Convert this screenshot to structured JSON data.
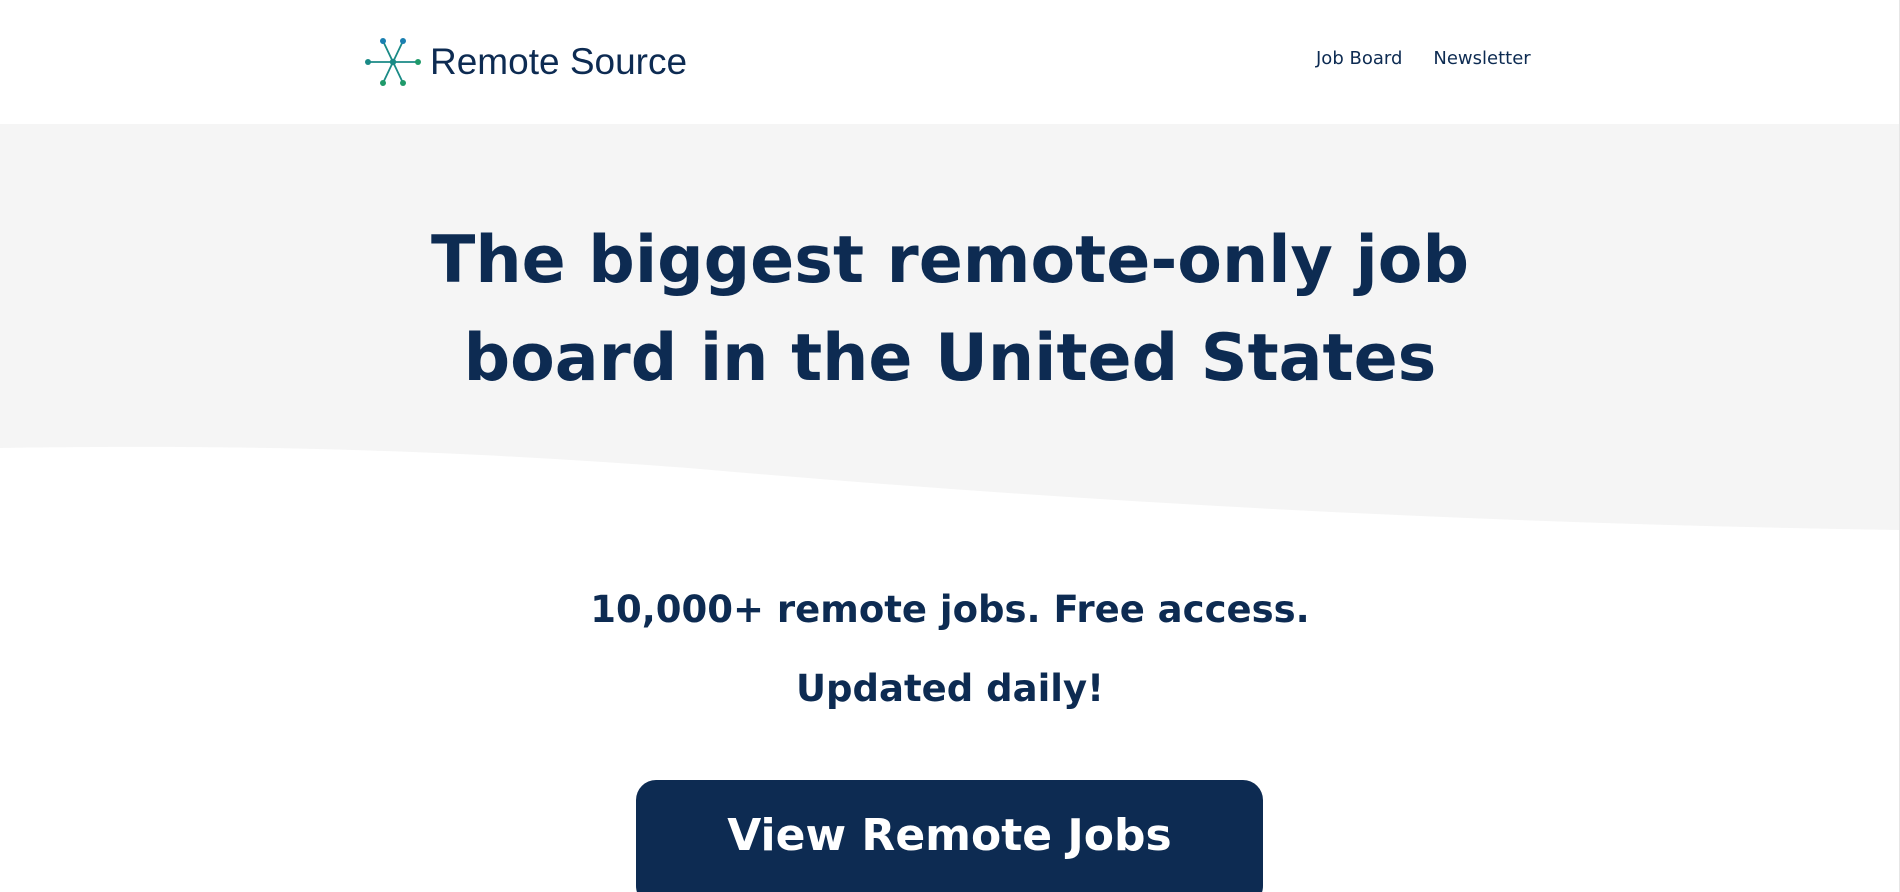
{
  "brand": {
    "name": "Remote Source",
    "icon": "network-star-icon"
  },
  "nav": {
    "items": [
      {
        "label": "Job Board"
      },
      {
        "label": "Newsletter"
      }
    ]
  },
  "hero": {
    "title": "The biggest remote-only job board in the United States"
  },
  "content": {
    "tagline_1": "10,000+ remote jobs. Free access.",
    "tagline_2": "Updated daily!",
    "cta_label": "View Remote Jobs"
  },
  "colors": {
    "primary": "#0d2b52",
    "hero_bg": "#f5f5f5",
    "logo_teal": "#1a8a86",
    "logo_green": "#1f9a6a",
    "logo_blue": "#1a7fb0"
  }
}
